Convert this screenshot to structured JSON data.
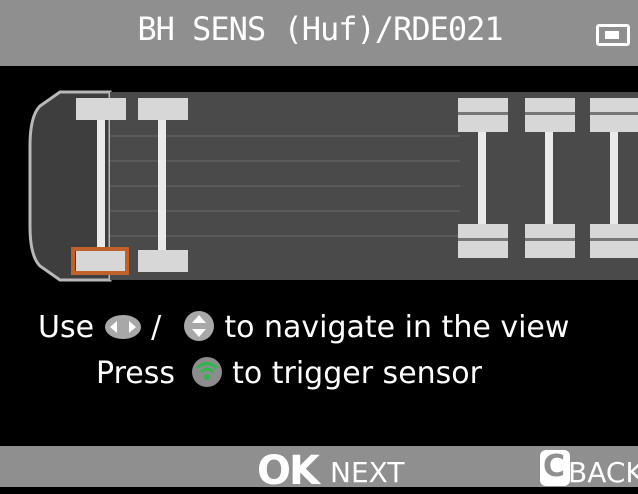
{
  "header": {
    "title": "BH SENS (Huf)/RDE021",
    "status_icon": "battery-icon"
  },
  "vehicle": {
    "type": "truck-top-view",
    "axles": 5,
    "selected_tire": "front-left",
    "selection_color": "#c0602a"
  },
  "instructions": {
    "line1_prefix": "Use",
    "line1_separator": "/",
    "line1_suffix": "to navigate in the view",
    "line2_prefix": "Press",
    "line2_suffix": "to trigger sensor",
    "nav_lr_icon": "left-right-arrows-icon",
    "nav_ud_icon": "up-down-arrows-icon",
    "trigger_icon": "wifi-trigger-icon",
    "trigger_color": "#2db84d"
  },
  "footer": {
    "ok_key": "OK",
    "next_label": "NEXT",
    "back_key": "C",
    "back_label": "BACK"
  }
}
